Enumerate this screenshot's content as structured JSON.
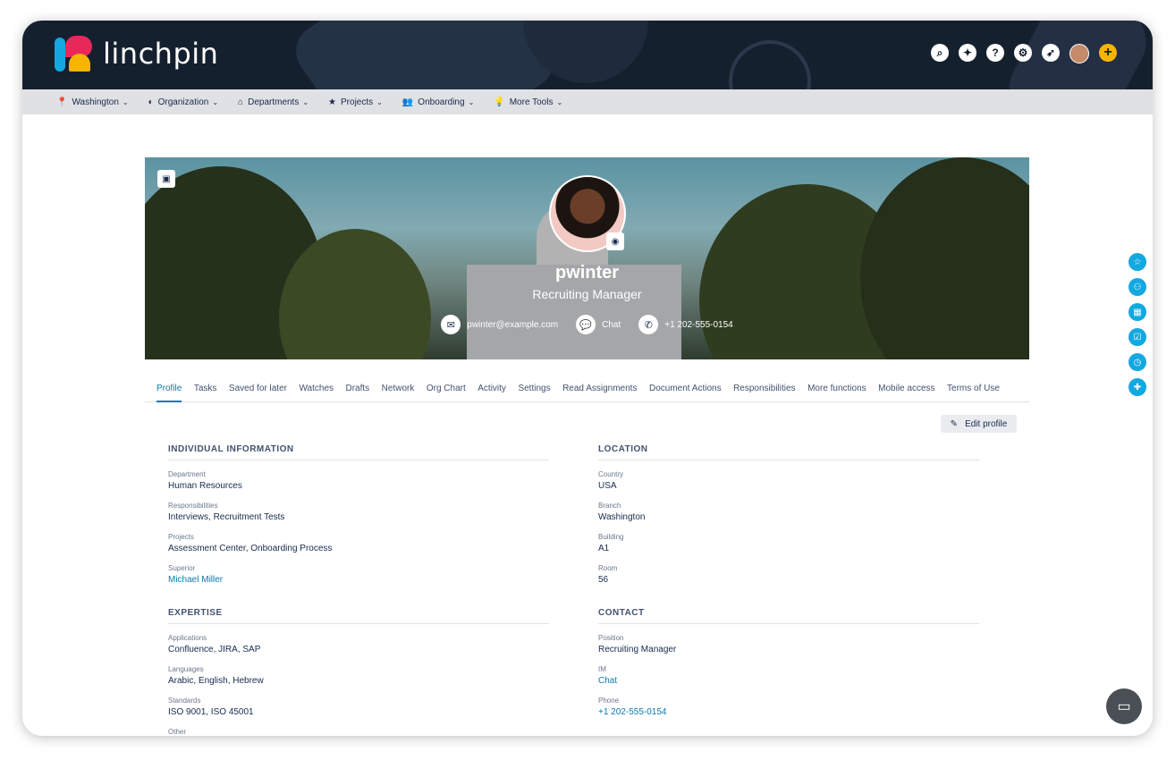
{
  "app": {
    "logo_text": "linchpin"
  },
  "header_icons": [
    {
      "name": "search-icon",
      "glyph": "⌕"
    },
    {
      "name": "compass-icon",
      "glyph": "✦"
    },
    {
      "name": "help-icon",
      "glyph": "?"
    },
    {
      "name": "settings-icon",
      "glyph": "⚙"
    },
    {
      "name": "rocket-icon",
      "glyph": "➶"
    },
    {
      "name": "user-avatar-icon",
      "glyph": ""
    },
    {
      "name": "plus-icon",
      "glyph": "+"
    }
  ],
  "nav": {
    "items": [
      {
        "label": "Washington",
        "icon": "📍"
      },
      {
        "label": "Organization",
        "icon": "◐"
      },
      {
        "label": "Departments",
        "icon": "⌂"
      },
      {
        "label": "Projects",
        "icon": "★"
      },
      {
        "label": "Onboarding",
        "icon": "👥"
      },
      {
        "label": "More Tools",
        "icon": "💡"
      }
    ],
    "chevron": "⌄"
  },
  "profile": {
    "name": "pwinter",
    "role": "Recruiting Manager",
    "email": "pwinter@example.com",
    "chat": "Chat",
    "phone": "+1 202-555-0154"
  },
  "tabs": [
    "Profile",
    "Tasks",
    "Saved for later",
    "Watches",
    "Drafts",
    "Network",
    "Org Chart",
    "Activity",
    "Settings",
    "Read Assignments",
    "Document Actions",
    "Responsibilities",
    "More functions",
    "Mobile access",
    "Terms of Use"
  ],
  "edit_profile": "Edit profile",
  "sections": {
    "individual": {
      "title": "INDIVIDUAL INFORMATION",
      "fields": [
        {
          "label": "Department",
          "value": "Human Resources"
        },
        {
          "label": "Responsibilities",
          "value": "Interviews, Recruitment Tests"
        },
        {
          "label": "Projects",
          "value": "Assessment Center, Onboarding Process"
        },
        {
          "label": "Superior",
          "value": "Michael Miller"
        }
      ]
    },
    "location": {
      "title": "LOCATION",
      "fields": [
        {
          "label": "Country",
          "value": "USA"
        },
        {
          "label": "Branch",
          "value": "Washington"
        },
        {
          "label": "Building",
          "value": "A1"
        },
        {
          "label": "Room",
          "value": "56"
        }
      ]
    },
    "expertise": {
      "title": "EXPERTISE",
      "fields": [
        {
          "label": "Applications",
          "value": "Confluence, JIRA, SAP"
        },
        {
          "label": "Languages",
          "value": "Arabic, English, Hebrew"
        },
        {
          "label": "Standards",
          "value": "ISO 9001, ISO 45001"
        },
        {
          "label": "Other",
          "value": ""
        }
      ]
    },
    "contact": {
      "title": "CONTACT",
      "fields": [
        {
          "label": "Position",
          "value": "Recruiting Manager"
        },
        {
          "label": "IM",
          "value": "Chat"
        },
        {
          "label": "Phone",
          "value": "+1 202-555-0154"
        }
      ]
    }
  },
  "rail": [
    "star-icon",
    "people-icon",
    "grid-icon",
    "checkbox-icon",
    "clock-icon",
    "puzzle-icon"
  ],
  "colors": {
    "accent": "#12a9e0",
    "link": "#0b79b0",
    "header_bg": "#15202f",
    "plus": "#f7b500"
  }
}
